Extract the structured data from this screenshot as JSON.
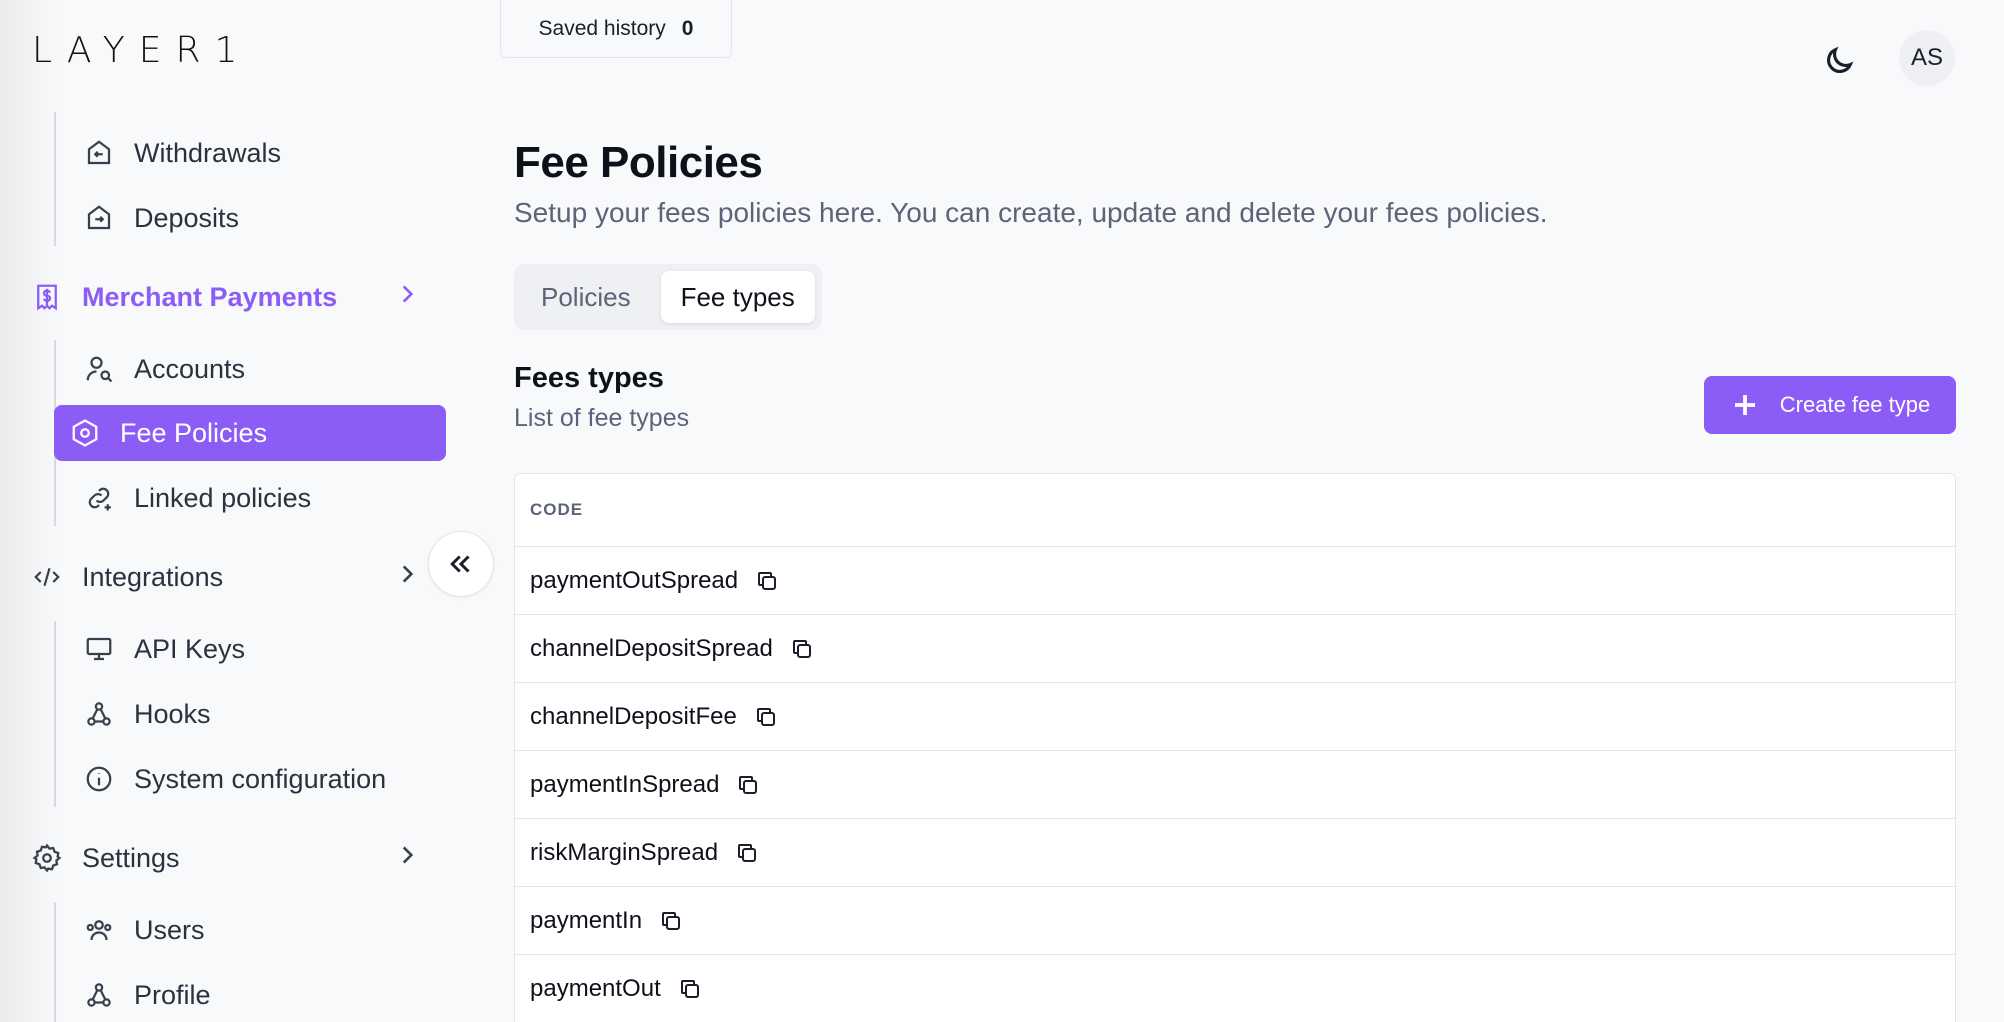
{
  "brand": {
    "logo_text": "LAYER1"
  },
  "topbar": {
    "saved_history_label": "Saved history",
    "saved_history_count": "0",
    "theme_icon": "moon-icon",
    "avatar_initials": "AS"
  },
  "sidebar": {
    "sub_top": [
      {
        "label": "Withdrawals",
        "icon": "withdrawals-icon"
      },
      {
        "label": "Deposits",
        "icon": "deposits-icon"
      }
    ],
    "merchant_payments": {
      "label": "Merchant Payments",
      "icon": "receipt-dollar-icon",
      "items": [
        {
          "label": "Accounts",
          "icon": "user-search-icon"
        },
        {
          "label": "Fee Policies",
          "icon": "hexagon-icon",
          "active": true
        },
        {
          "label": "Linked policies",
          "icon": "link-icon"
        }
      ]
    },
    "integrations": {
      "label": "Integrations",
      "icon": "code-icon",
      "items": [
        {
          "label": "API Keys",
          "icon": "monitor-icon"
        },
        {
          "label": "Hooks",
          "icon": "webhook-icon"
        },
        {
          "label": "System configuration",
          "icon": "info-icon"
        }
      ]
    },
    "settings": {
      "label": "Settings",
      "icon": "gear-icon",
      "items": [
        {
          "label": "Users",
          "icon": "users-icon"
        },
        {
          "label": "Profile",
          "icon": "webhook-icon"
        }
      ]
    }
  },
  "main": {
    "title": "Fee Policies",
    "subtitle": "Setup your fees policies here. You can create, update and delete your fees policies.",
    "tabs": [
      {
        "label": "Policies",
        "selected": false
      },
      {
        "label": "Fee types",
        "selected": true
      }
    ],
    "section_title": "Fees types",
    "section_subtitle": "List of fee types",
    "create_button_label": "Create fee type",
    "table": {
      "column_header": "CODE",
      "rows": [
        "paymentOutSpread",
        "channelDepositSpread",
        "channelDepositFee",
        "paymentInSpread",
        "riskMarginSpread",
        "paymentIn",
        "paymentOut"
      ]
    }
  },
  "colors": {
    "accent": "#8b5cf6",
    "background": "#f8f9fb",
    "text_muted": "#5b6478"
  }
}
